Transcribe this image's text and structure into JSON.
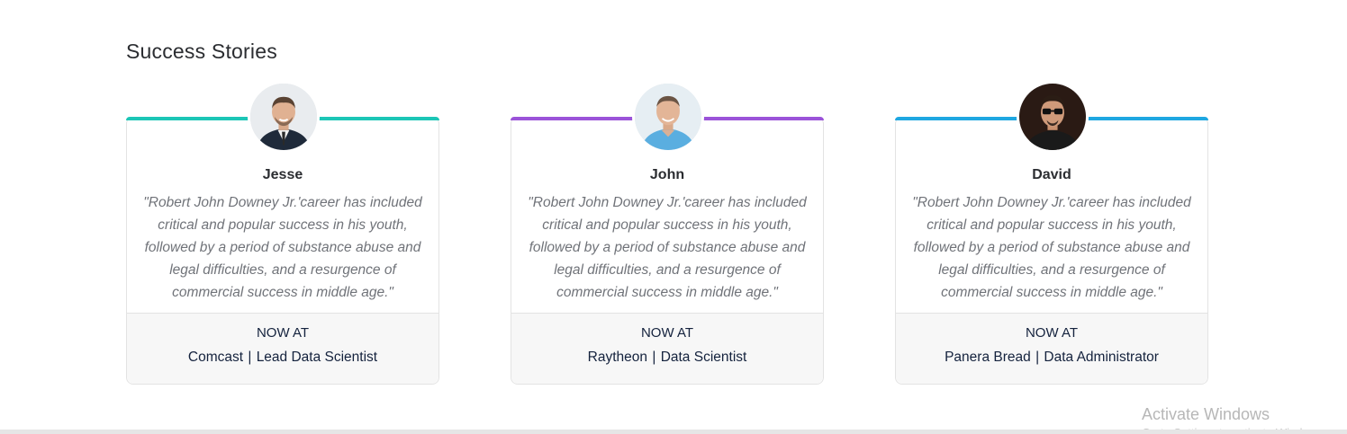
{
  "section": {
    "title": "Success Stories"
  },
  "cards": [
    {
      "name": "Jesse",
      "accent": "#1cc6b6",
      "quote": "\"Robert John Downey Jr.'career has included critical and popular success in his youth, followed by a period of substance abuse and legal difficulties, and a resurgence of commercial success in middle age.\"",
      "now_at": "NOW AT",
      "company": "Comcast",
      "separator": "|",
      "role": "Lead Data Scientist"
    },
    {
      "name": "John",
      "accent": "#9b53d9",
      "quote": "\"Robert John Downey Jr.'career has included critical and popular success in his youth, followed by a period of substance abuse and legal difficulties, and a resurgence of commercial success in middle age.\"",
      "now_at": "NOW AT",
      "company": "Raytheon",
      "separator": "|",
      "role": "Data Scientist"
    },
    {
      "name": "David",
      "accent": "#1ea7e1",
      "quote": "\"Robert John Downey Jr.'career has included critical and popular success in his youth, followed by a period of substance abuse and legal difficulties, and a resurgence of commercial success in middle age.\"",
      "now_at": "NOW AT",
      "company": "Panera Bread",
      "separator": "|",
      "role": "Data Administrator"
    }
  ],
  "os_watermark": {
    "title": "Activate Windows",
    "subtitle": "Go to Settings to activate Windows."
  }
}
